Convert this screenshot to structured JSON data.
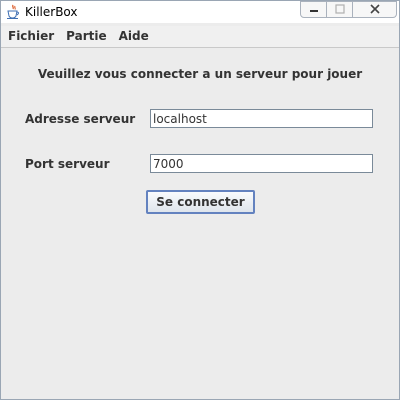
{
  "window": {
    "title": "KillerBox",
    "app_icon": "java-cup-icon",
    "controls": {
      "minimize_icon": "minimize-icon",
      "maximize_icon": "maximize-icon",
      "close_icon": "close-icon"
    }
  },
  "menubar": {
    "items": [
      {
        "label": "Fichier"
      },
      {
        "label": "Partie"
      },
      {
        "label": "Aide"
      }
    ]
  },
  "main": {
    "heading": "Veuillez vous connecter a un serveur pour jouer",
    "address": {
      "label": "Adresse serveur",
      "value": "localhost"
    },
    "port": {
      "label": "Port serveur",
      "value": "7000"
    },
    "connect_label": "Se connecter"
  },
  "colors": {
    "window_background": "#ececec",
    "button_border": "#6382bf",
    "input_border": "#7a8a99"
  }
}
